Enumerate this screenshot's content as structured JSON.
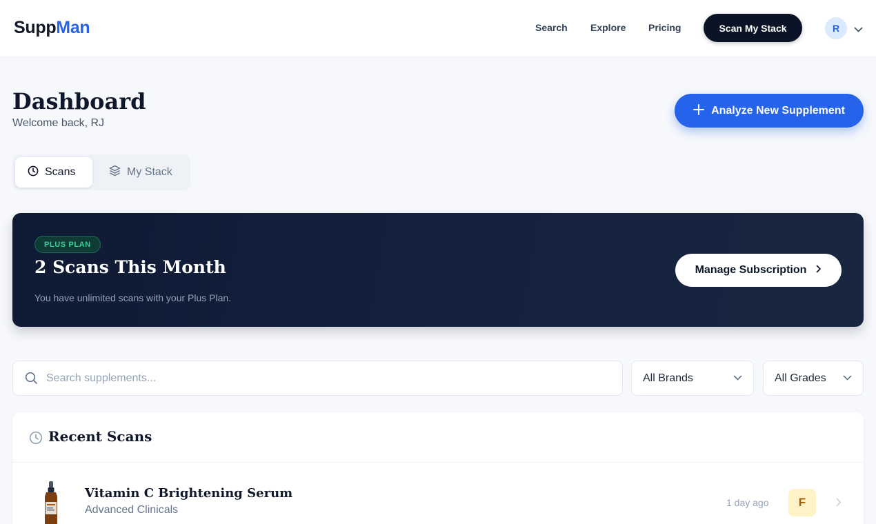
{
  "header": {
    "logo_part1": "Supp",
    "logo_part2": "Man",
    "nav": {
      "search": "Search",
      "explore": "Explore",
      "pricing": "Pricing"
    },
    "cta": "Scan My Stack",
    "avatar_initial": "R"
  },
  "page": {
    "title": "Dashboard",
    "welcome": "Welcome back, RJ",
    "analyze_button": "Analyze New Supplement"
  },
  "tabs": {
    "scans": "Scans",
    "stack": "My Stack"
  },
  "plan": {
    "badge": "PLUS PLAN",
    "title": "2 Scans This Month",
    "subtitle": "You have unlimited scans with your Plus Plan.",
    "manage_button": "Manage Subscription"
  },
  "filters": {
    "search_placeholder": "Search supplements...",
    "brand_select": "All Brands",
    "grade_select": "All Grades"
  },
  "recent": {
    "title": "Recent Scans",
    "items": [
      {
        "name": "Vitamin C Brightening Serum",
        "brand": "Advanced Clinicals",
        "time": "1 day ago",
        "grade": "F"
      }
    ]
  },
  "colors": {
    "brand_blue": "#2563eb",
    "dark_navy": "#0b1426",
    "plan_green": "#34d399",
    "grade_f_bg": "#fef3c7"
  }
}
